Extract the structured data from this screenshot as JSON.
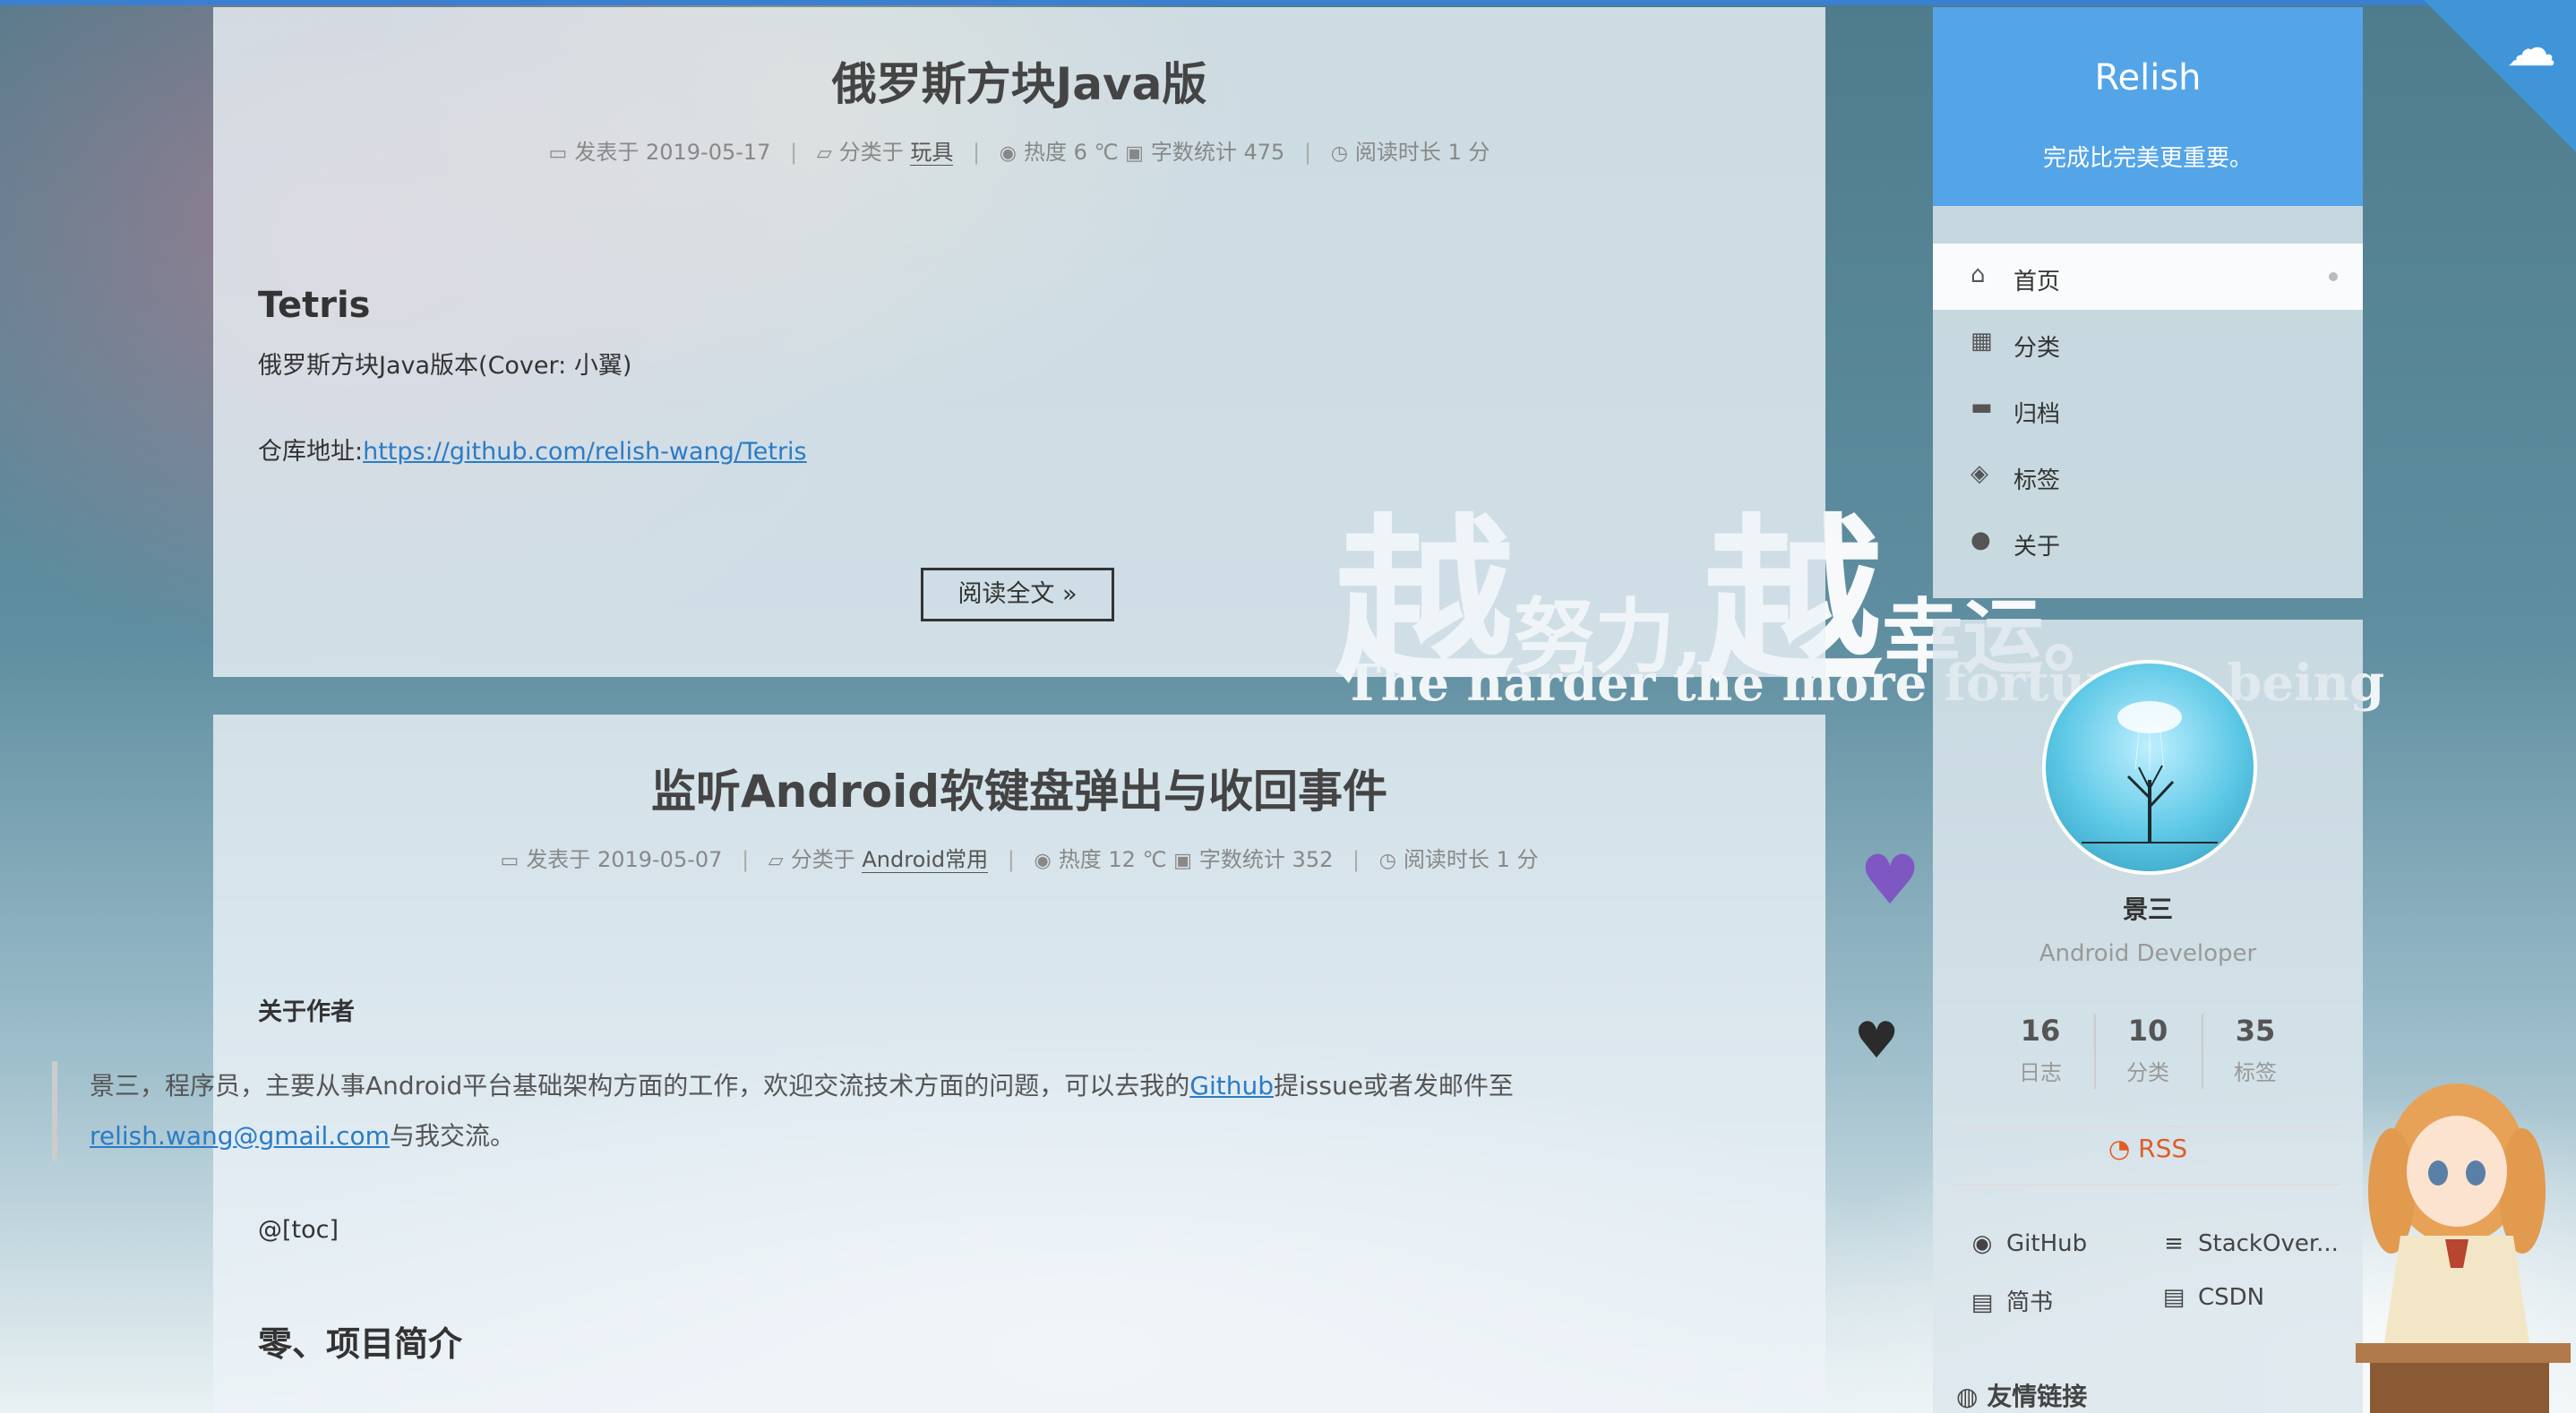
{
  "posts": [
    {
      "title": "俄罗斯方块Java版",
      "meta": {
        "posted": "发表于 2019-05-17",
        "category_prefix": "分类于",
        "category": "玩具",
        "heat": "热度 6 ℃",
        "words": "字数统计 475",
        "readtime": "阅读时长 1 分"
      },
      "h3": "Tetris",
      "p1": "俄罗斯方块Java版本(Cover: 小翼)",
      "repo_prefix": "仓库地址:",
      "repo_link": "https://github.com/relish-wang/Tetris",
      "read_more": "阅读全文 »"
    },
    {
      "title": "监听Android软键盘弹出与收回事件",
      "meta": {
        "posted": "发表于 2019-05-07",
        "category_prefix": "分类于",
        "category": "Android常用",
        "heat": "热度 12 ℃",
        "words": "字数统计 352",
        "readtime": "阅读时长 1 分"
      },
      "about_heading": "关于作者",
      "quote_part1": "景三，程序员，主要从事Android平台基础架构方面的工作，欢迎交流技术方面的问题，可以去我的",
      "quote_github": "Github",
      "quote_part2": "提issue或者发邮件至",
      "quote_email": "relish.wang@gmail.com",
      "quote_part3": "与我交流。",
      "toc": "@[toc]",
      "section_title": "零、项目简介"
    }
  ],
  "sidebar": {
    "brand": "Relish",
    "subtitle": "完成比完美更重要。",
    "menu": [
      {
        "label": "首页",
        "icon": "home-icon",
        "glyph": "⌂",
        "active": true
      },
      {
        "label": "分类",
        "icon": "grid-icon",
        "glyph": "▦",
        "active": false
      },
      {
        "label": "归档",
        "icon": "archive-icon",
        "glyph": "▬",
        "active": false
      },
      {
        "label": "标签",
        "icon": "tags-icon",
        "glyph": "◈",
        "active": false
      },
      {
        "label": "关于",
        "icon": "user-icon",
        "glyph": "●",
        "active": false
      }
    ],
    "author": "景三",
    "role": "Android Developer",
    "stats": [
      {
        "num": "16",
        "label": "日志"
      },
      {
        "num": "10",
        "label": "分类"
      },
      {
        "num": "35",
        "label": "标签"
      }
    ],
    "rss": "RSS",
    "social": [
      {
        "label": "GitHub",
        "icon": "github-icon",
        "glyph": "◉"
      },
      {
        "label": "StackOver...",
        "icon": "stackoverflow-icon",
        "glyph": "≡"
      },
      {
        "label": "简书",
        "icon": "book-icon",
        "glyph": "▤"
      },
      {
        "label": "CSDN",
        "icon": "book-icon",
        "glyph": "▤"
      }
    ],
    "friend_links": "友情链接"
  },
  "background_motto": {
    "big1": "越",
    "small1": "努力,",
    "big2": "越",
    "small2": "幸运。",
    "en": "The harder the more fortunate being"
  },
  "colors": {
    "accent": "#54a4e8",
    "link": "#2a7cc7",
    "rss": "#e05d23",
    "heart_purple": "#7e57c2"
  }
}
